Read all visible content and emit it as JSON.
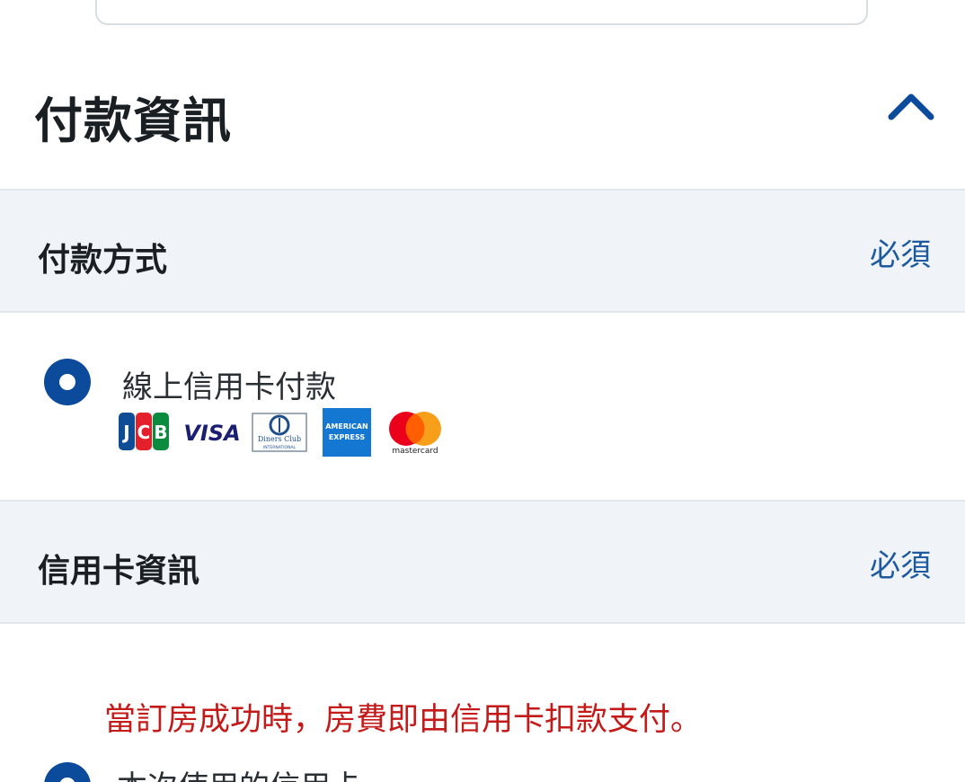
{
  "payment_section": {
    "title": "付款資訊",
    "collapse_icon": "chevron-up-icon"
  },
  "payment_method": {
    "label": "付款方式",
    "required": "必須",
    "options": [
      {
        "label": "線上信用卡付款",
        "selected": true,
        "card_brands": [
          "JCB",
          "VISA",
          "Diners Club",
          "American Express",
          "mastercard"
        ]
      }
    ]
  },
  "credit_card_info": {
    "label": "信用卡資訊",
    "required": "必須",
    "notice": "當訂房成功時，房費即由信用卡扣款支付。",
    "options": [
      {
        "label": "本次使用的信用卡",
        "selected": true
      }
    ]
  },
  "logos": {
    "jcb_text": "JCB",
    "visa_text": "VISA",
    "diners_line1": "Diners Club",
    "diners_line2": "INTERNATIONAL",
    "amex_line1": "AMERICAN",
    "amex_line2": "EXPRESS",
    "mastercard_text": "mastercard"
  },
  "colors": {
    "accent": "#0c4b9b",
    "band_bg": "#f0f4f8",
    "required_text": "#1d5aa0",
    "notice_text": "#c41a1a"
  }
}
